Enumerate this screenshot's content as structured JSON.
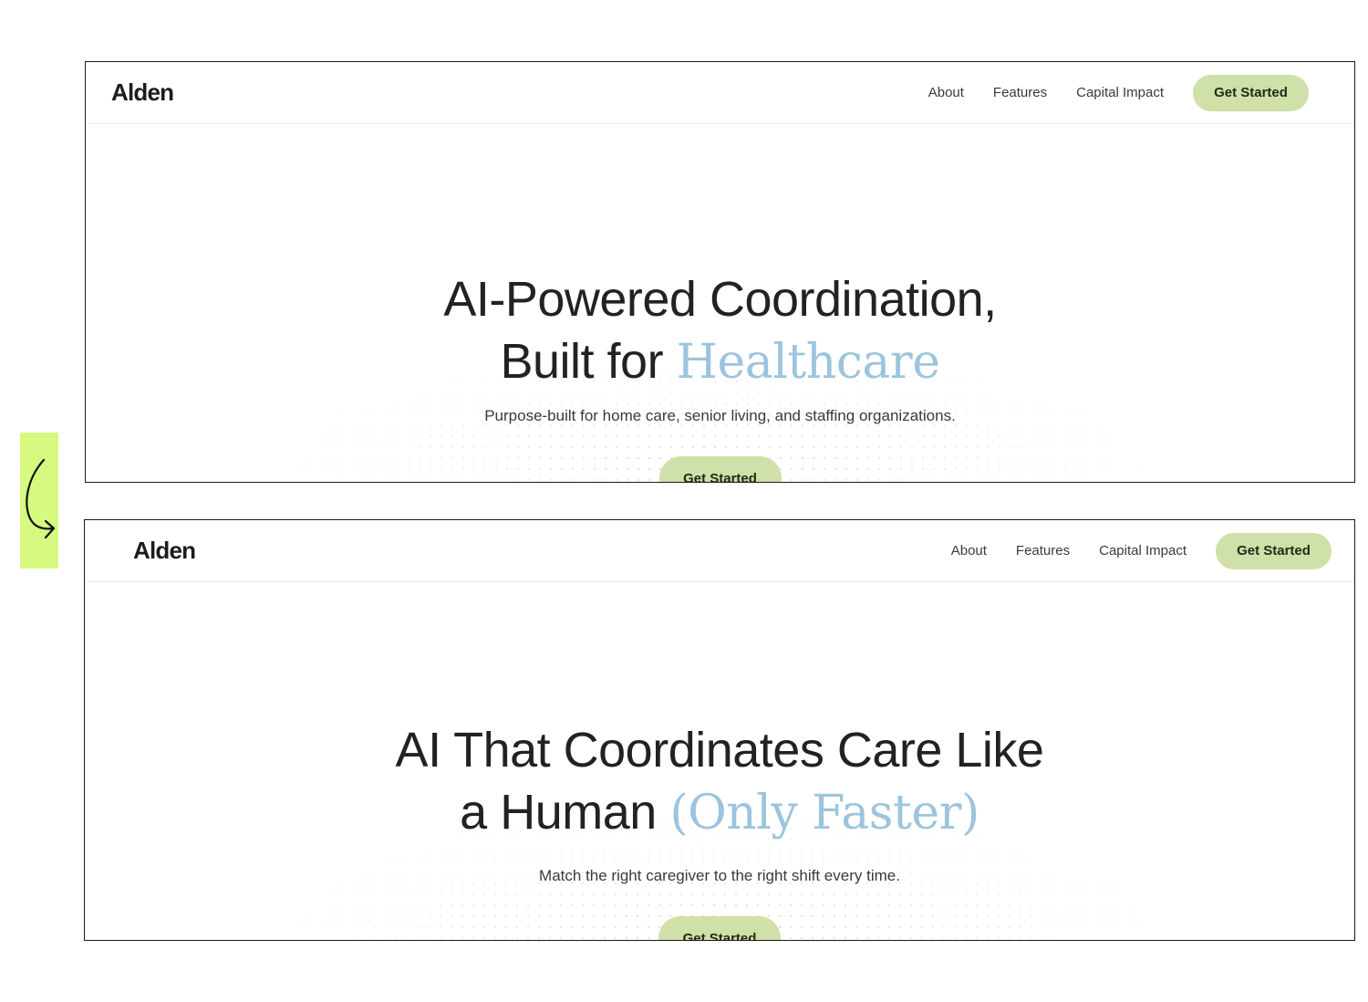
{
  "colors": {
    "accent_blue": "#9cc4dd",
    "button_green": "#cfe0a8",
    "marker_green": "#d6f97f",
    "text_dark": "#222222"
  },
  "arrow": {
    "icon": "curved-arrow-down-right-icon"
  },
  "before": {
    "logo": "Alden",
    "nav": {
      "about": "About",
      "features": "Features",
      "capital": "Capital Impact",
      "cta": "Get Started"
    },
    "headline": {
      "line1": "AI-Powered Coordination,",
      "line2_plain": "Built for",
      "line2_accent": "Healthcare"
    },
    "subheadline": "Purpose-built for home care, senior living, and staffing organizations.",
    "cta": "Get Started"
  },
  "after": {
    "logo": "Alden",
    "nav": {
      "about": "About",
      "features": "Features",
      "capital": "Capital Impact",
      "cta": "Get Started"
    },
    "headline": {
      "line1": "AI That Coordinates Care Like",
      "line2_plain": "a Human",
      "line2_accent": "(Only Faster)"
    },
    "subheadline": "Match the right caregiver to the right shift every time.",
    "cta": "Get Started"
  }
}
